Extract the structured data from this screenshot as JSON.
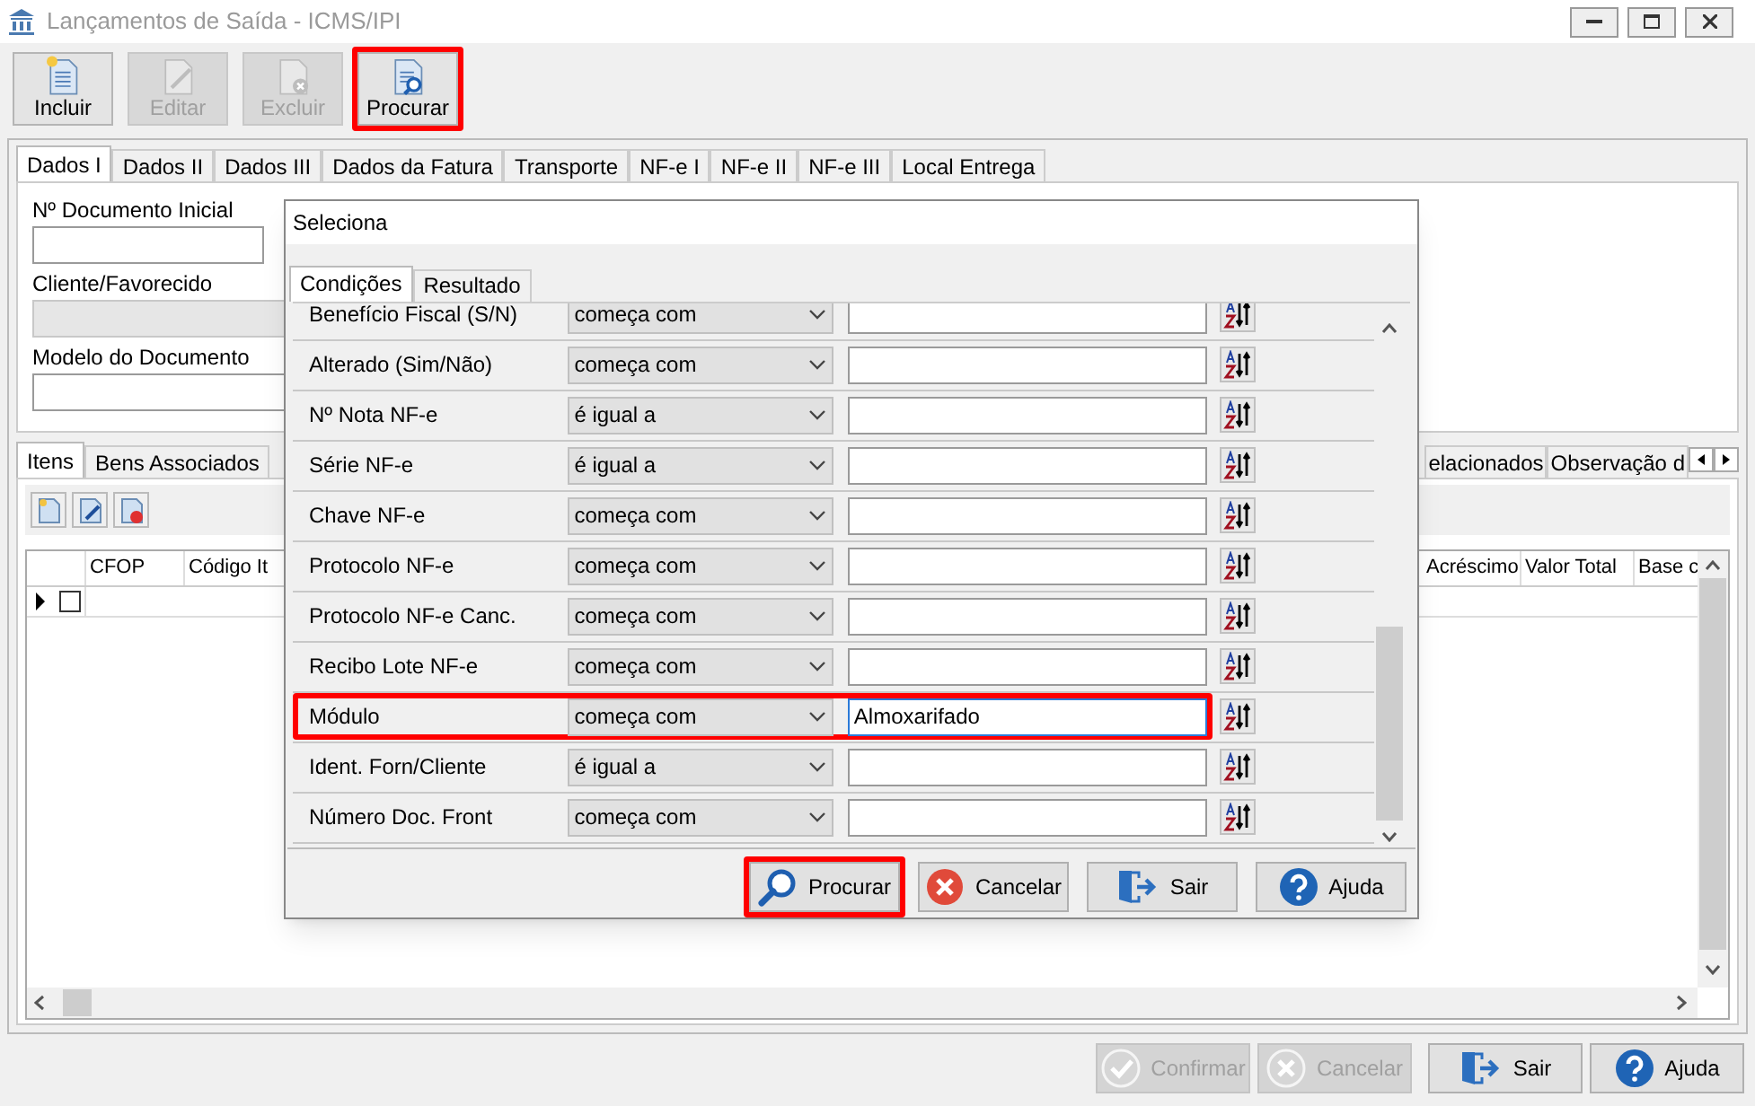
{
  "window": {
    "title": "Lançamentos de Saída - ICMS/IPI"
  },
  "toolbar": [
    {
      "label": "Incluir",
      "kind": "new",
      "disabled": false,
      "highlighted": false
    },
    {
      "label": "Editar",
      "kind": "edit",
      "disabled": true,
      "highlighted": false
    },
    {
      "label": "Excluir",
      "kind": "delete",
      "disabled": true,
      "highlighted": false
    },
    {
      "label": "Procurar",
      "kind": "search",
      "disabled": false,
      "highlighted": true
    }
  ],
  "main_tabs": [
    {
      "label": "Dados I",
      "selected": true
    },
    {
      "label": "Dados II",
      "selected": false
    },
    {
      "label": "Dados III",
      "selected": false
    },
    {
      "label": "Dados da Fatura",
      "selected": false
    },
    {
      "label": "Transporte",
      "selected": false
    },
    {
      "label": "NF-e I",
      "selected": false
    },
    {
      "label": "NF-e II",
      "selected": false
    },
    {
      "label": "NF-e III",
      "selected": false
    },
    {
      "label": "Local Entrega",
      "selected": false
    }
  ],
  "fields": [
    {
      "label": "Nº Documento Inicial",
      "disabled": false
    },
    {
      "label": "Cliente/Favorecido",
      "disabled": true
    },
    {
      "label": "Modelo do Documento",
      "disabled": false
    }
  ],
  "items_tabs": [
    {
      "label": "Itens",
      "selected": true
    },
    {
      "label": "Bens Associados",
      "selected": false
    },
    {
      "label": "elacionados",
      "selected": false
    },
    {
      "label": "Observação d",
      "selected": false
    }
  ],
  "grid": {
    "columns": [
      "CFOP",
      "Código It",
      "Acréscimo",
      "Valor Total",
      "Base c"
    ],
    "rows": [
      {
        "checked": false
      }
    ]
  },
  "dialog": {
    "title": "Seleciona",
    "tabs": [
      {
        "label": "Condições",
        "selected": true
      },
      {
        "label": "Resultado",
        "selected": false
      }
    ],
    "conditions": [
      {
        "field": "Benefício Fiscal (S/N)",
        "operator": "começa com",
        "highlighted": false
      },
      {
        "field": "Alterado (Sim/Não)",
        "operator": "começa com",
        "highlighted": false
      },
      {
        "field": "Nº Nota NF-e",
        "operator": "é igual a",
        "highlighted": false
      },
      {
        "field": "Série NF-e",
        "operator": "é igual a",
        "highlighted": false
      },
      {
        "field": "Chave NF-e",
        "operator": "começa com",
        "highlighted": false
      },
      {
        "field": "Protocolo NF-e",
        "operator": "começa com",
        "highlighted": false
      },
      {
        "field": "Protocolo NF-e Canc.",
        "operator": "começa com",
        "highlighted": false
      },
      {
        "field": "Recibo Lote NF-e",
        "operator": "começa com",
        "highlighted": false
      },
      {
        "field": "Módulo",
        "operator": "começa com",
        "value": "Almoxarifado",
        "highlighted": true
      },
      {
        "field": "Ident. Forn/Cliente",
        "operator": "é igual a",
        "highlighted": false
      },
      {
        "field": "Número Doc. Front",
        "operator": "começa com",
        "highlighted": false
      }
    ],
    "buttons": [
      {
        "label": "Procurar",
        "kind": "search",
        "highlighted": true
      },
      {
        "label": "Cancelar",
        "kind": "cancel",
        "highlighted": false
      },
      {
        "label": "Sair",
        "kind": "exit",
        "highlighted": false
      },
      {
        "label": "Ajuda",
        "kind": "help",
        "highlighted": false
      }
    ]
  },
  "bottom_buttons": [
    {
      "label": "Confirmar",
      "kind": "confirm",
      "disabled": true
    },
    {
      "label": "Cancelar",
      "kind": "cancel",
      "disabled": true
    },
    {
      "label": "Sair",
      "kind": "exit",
      "disabled": false
    },
    {
      "label": "Ajuda",
      "kind": "help",
      "disabled": false
    }
  ]
}
